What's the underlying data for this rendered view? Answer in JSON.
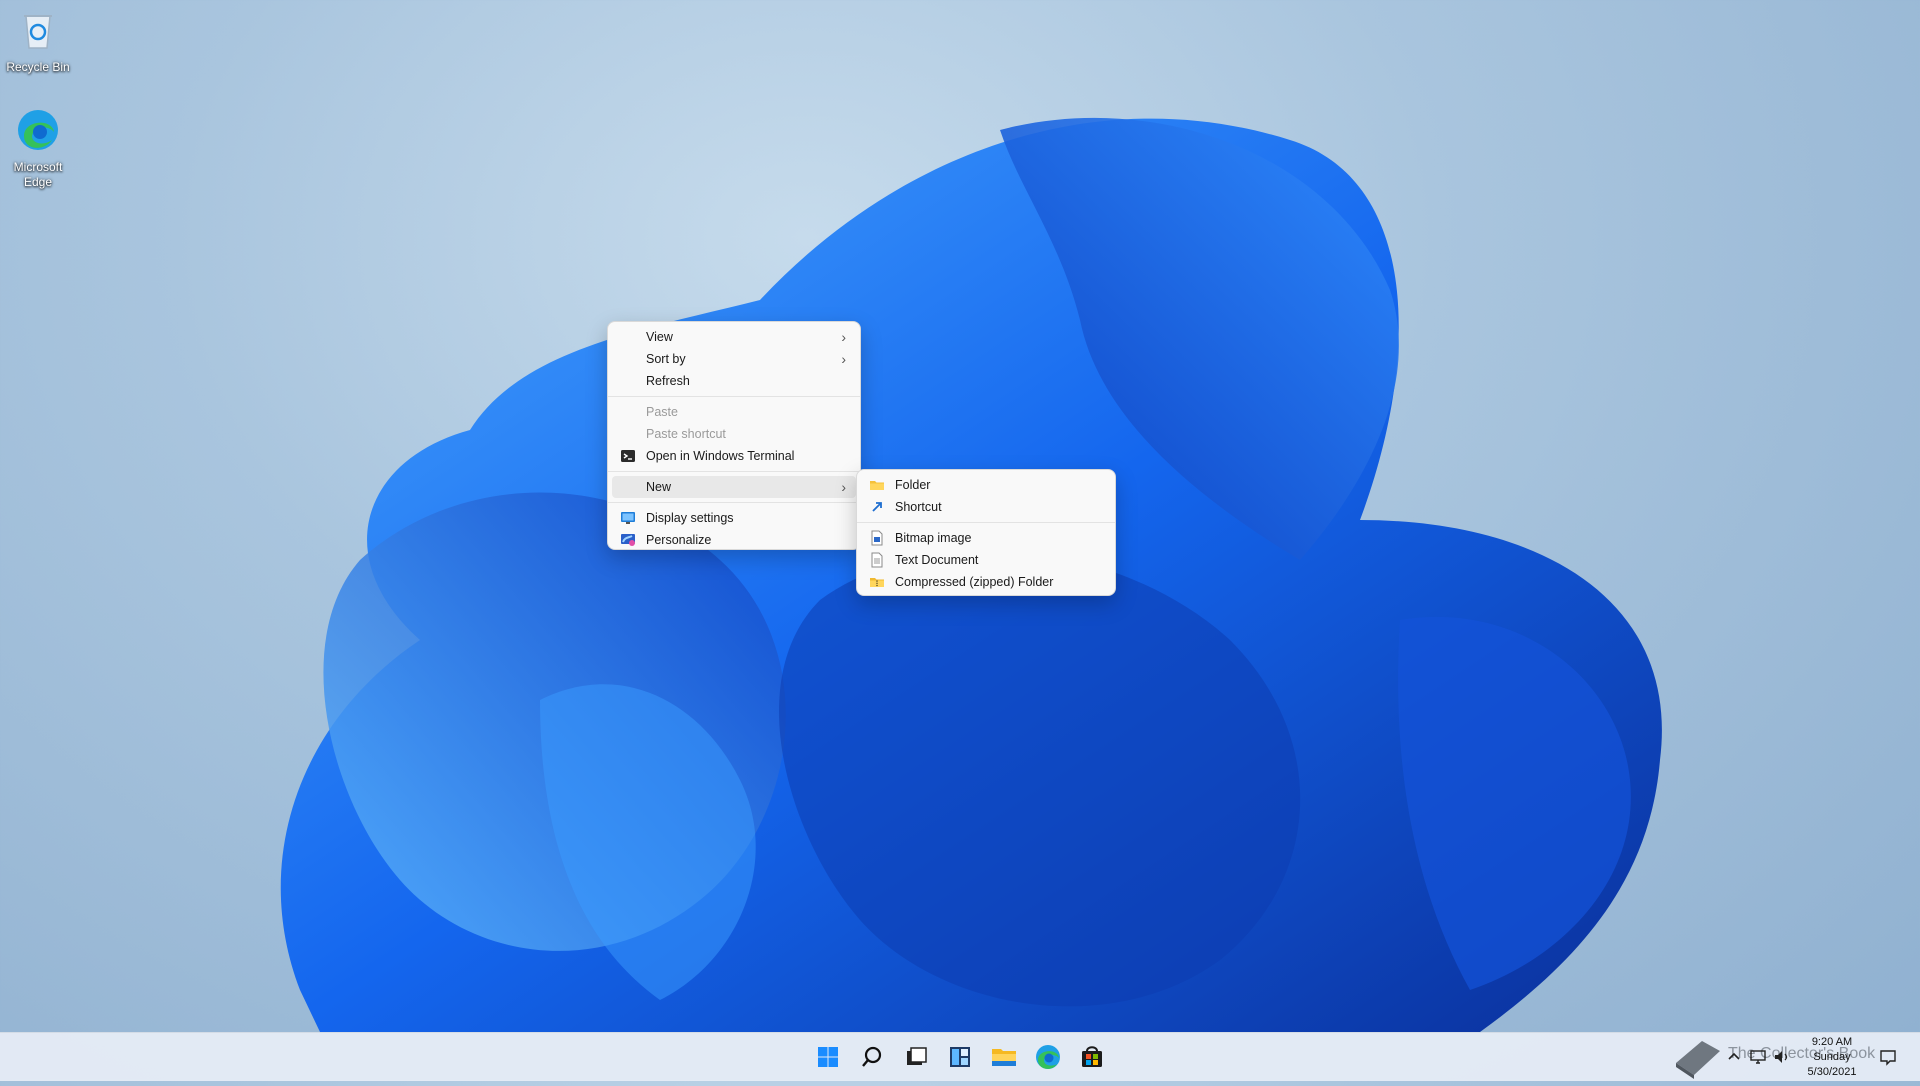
{
  "desktop": {
    "icons": [
      {
        "label": "Recycle Bin"
      },
      {
        "label": "Microsoft Edge"
      }
    ]
  },
  "context_menu": {
    "items": [
      {
        "label": "View",
        "has_submenu": true,
        "enabled": true
      },
      {
        "label": "Sort by",
        "has_submenu": true,
        "enabled": true
      },
      {
        "label": "Refresh",
        "enabled": true
      },
      {
        "label": "Paste",
        "enabled": false
      },
      {
        "label": "Paste shortcut",
        "enabled": false
      },
      {
        "label": "Open in Windows Terminal",
        "icon": "terminal-icon",
        "enabled": true
      },
      {
        "label": "New",
        "has_submenu": true,
        "enabled": true,
        "active": true
      },
      {
        "label": "Display settings",
        "icon": "display-icon",
        "enabled": true
      },
      {
        "label": "Personalize",
        "icon": "personalize-icon",
        "enabled": true
      }
    ]
  },
  "new_submenu": {
    "items": [
      {
        "label": "Folder",
        "icon": "folder-icon"
      },
      {
        "label": "Shortcut",
        "icon": "shortcut-icon"
      },
      {
        "label": "Bitmap image",
        "icon": "bitmap-icon"
      },
      {
        "label": "Text Document",
        "icon": "text-document-icon"
      },
      {
        "label": "Compressed (zipped) Folder",
        "icon": "zip-folder-icon"
      }
    ]
  },
  "taskbar": {
    "apps": [
      "start-icon",
      "search-icon",
      "task-view-icon",
      "widgets-icon",
      "file-explorer-icon",
      "edge-icon",
      "store-icon"
    ]
  },
  "tray": {
    "time": "9:20 AM",
    "day": "Sunday",
    "date": "5/30/2021"
  },
  "watermark": {
    "text": "The Collector's Book"
  },
  "colors": {
    "accent": "#0067c0",
    "wallpaper_blue": "#1560e8"
  }
}
